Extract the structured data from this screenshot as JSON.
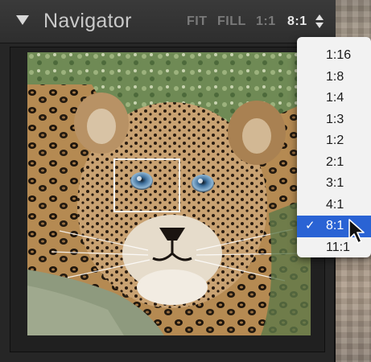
{
  "panel": {
    "title": "Navigator",
    "zoom_options": [
      "FIT",
      "FILL",
      "1:1",
      "8:1"
    ],
    "active_zoom": "8:1"
  },
  "icons": {
    "collapse": "disclosure-triangle-down-icon",
    "stepper": "up-down-stepper-icon",
    "check": "checkmark-icon",
    "cursor": "arrow-pointer-icon"
  },
  "preview": {
    "subject": "leopard cub photo"
  },
  "zoom_menu": {
    "items": [
      "1:16",
      "1:8",
      "1:4",
      "1:3",
      "1:2",
      "2:1",
      "3:1",
      "4:1",
      "8:1",
      "11:1"
    ],
    "selected_index": 8,
    "check_glyph": "✓"
  },
  "colors": {
    "panel_bg": "#262626",
    "menu_bg": "#f2f2f2",
    "selection": "#2a63d4",
    "text_active": "#e8e8e8",
    "text_inactive": "#7a7a7a"
  }
}
